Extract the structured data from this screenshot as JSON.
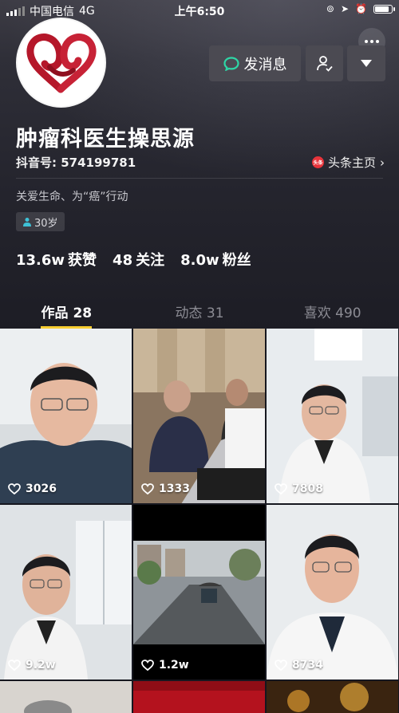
{
  "status_bar": {
    "carrier": "中国电信",
    "network": "4G",
    "time": "上午6:50"
  },
  "profile": {
    "name": "肿瘤科医生操思源",
    "douyin_id": "抖音号: 574199781",
    "toutiao_link": "头条主页",
    "toutiao_logo_text": "头条",
    "bio": "关爱生命、为“癌”行动",
    "age_tag": "30岁"
  },
  "actions": {
    "message_label": "发消息"
  },
  "stats": [
    {
      "value": "13.6w",
      "label": "获赞"
    },
    {
      "value": "48",
      "label": "关注"
    },
    {
      "value": "8.0w",
      "label": "粉丝"
    }
  ],
  "tabs": [
    {
      "label": "作品 28",
      "active": true
    },
    {
      "label": "动态 31",
      "active": false
    },
    {
      "label": "喜欢 490",
      "active": false
    }
  ],
  "videos": [
    {
      "likes": "3026"
    },
    {
      "likes": "1333"
    },
    {
      "likes": "7808"
    },
    {
      "likes": "9.2w"
    },
    {
      "likes": "1.2w"
    },
    {
      "likes": "8734"
    }
  ],
  "colors": {
    "accent_tab": "#f7cd32",
    "message_icon": "#2ed6a6",
    "toutiao": "#e8343b",
    "avatar_ribbon": "#b5172a",
    "age_icon": "#3ec1d6"
  }
}
